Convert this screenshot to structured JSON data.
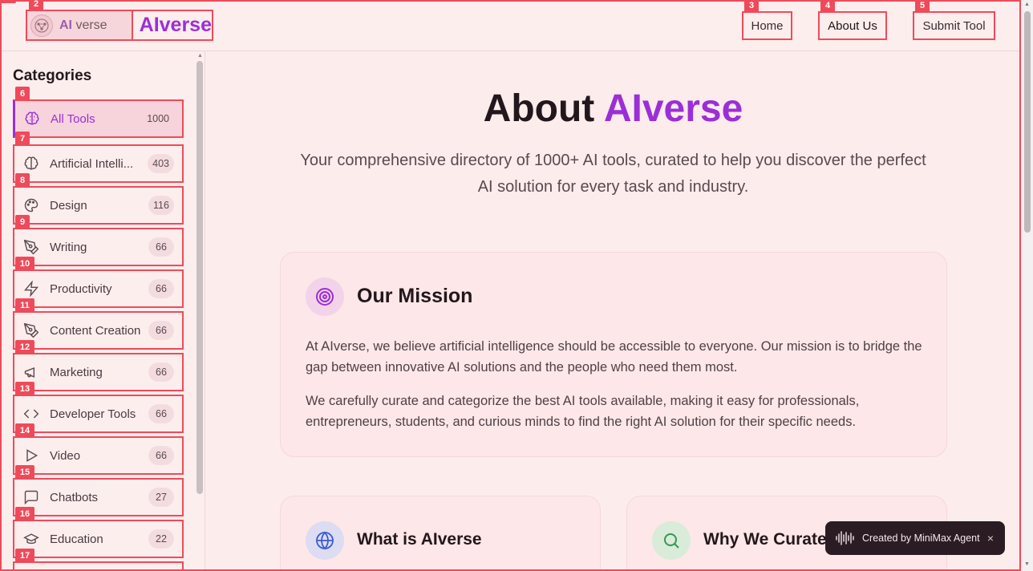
{
  "header": {
    "logo_image_text": {
      "ai": "AI",
      "verse": "verse"
    },
    "logo_name": "AIverse",
    "nav": [
      {
        "label": "Home"
      },
      {
        "label": "About Us"
      },
      {
        "label": "Submit Tool"
      }
    ]
  },
  "sidebar": {
    "title": "Categories",
    "items": [
      {
        "label": "All Tools",
        "count": "1000",
        "icon": "brain-icon",
        "active": true
      },
      {
        "label": "Artificial Intelli...",
        "count": "403",
        "icon": "brain-icon"
      },
      {
        "label": "Design",
        "count": "116",
        "icon": "palette-icon"
      },
      {
        "label": "Writing",
        "count": "66",
        "icon": "pen-tool-icon"
      },
      {
        "label": "Productivity",
        "count": "66",
        "icon": "zap-icon"
      },
      {
        "label": "Content Creation",
        "count": "66",
        "icon": "pen-tool-icon"
      },
      {
        "label": "Marketing",
        "count": "66",
        "icon": "megaphone-icon"
      },
      {
        "label": "Developer Tools",
        "count": "66",
        "icon": "code-icon"
      },
      {
        "label": "Video",
        "count": "66",
        "icon": "play-icon"
      },
      {
        "label": "Chatbots",
        "count": "27",
        "icon": "message-square-icon"
      },
      {
        "label": "Education",
        "count": "22",
        "icon": "graduation-cap-icon"
      }
    ]
  },
  "main": {
    "title_prefix": "About ",
    "title_accent": "AIverse",
    "subtitle": "Your comprehensive directory of 1000+ AI tools, curated to help you discover the perfect AI solution for every task and industry.",
    "mission": {
      "title": "Our Mission",
      "p1": "At AIverse, we believe artificial intelligence should be accessible to everyone. Our mission is to bridge the gap between innovative AI solutions and the people who need them most.",
      "p2": "We carefully curate and categorize the best AI tools available, making it easy for professionals, entrepreneurs, students, and curious minds to find the right AI solution for their specific needs."
    },
    "what_is": {
      "title": "What is AIverse"
    },
    "why": {
      "title": "Why We Curate"
    }
  },
  "toast": {
    "text": "Created by MiniMax Agent",
    "close": "×"
  },
  "annotations": [
    "2",
    "3",
    "4",
    "5",
    "6",
    "7",
    "8",
    "9",
    "10",
    "11",
    "12",
    "13",
    "14",
    "15",
    "16",
    "17"
  ],
  "colors": {
    "accent": "#9b2fd6",
    "highlight_border": "#ef4a5a",
    "background": "#fdecec"
  }
}
